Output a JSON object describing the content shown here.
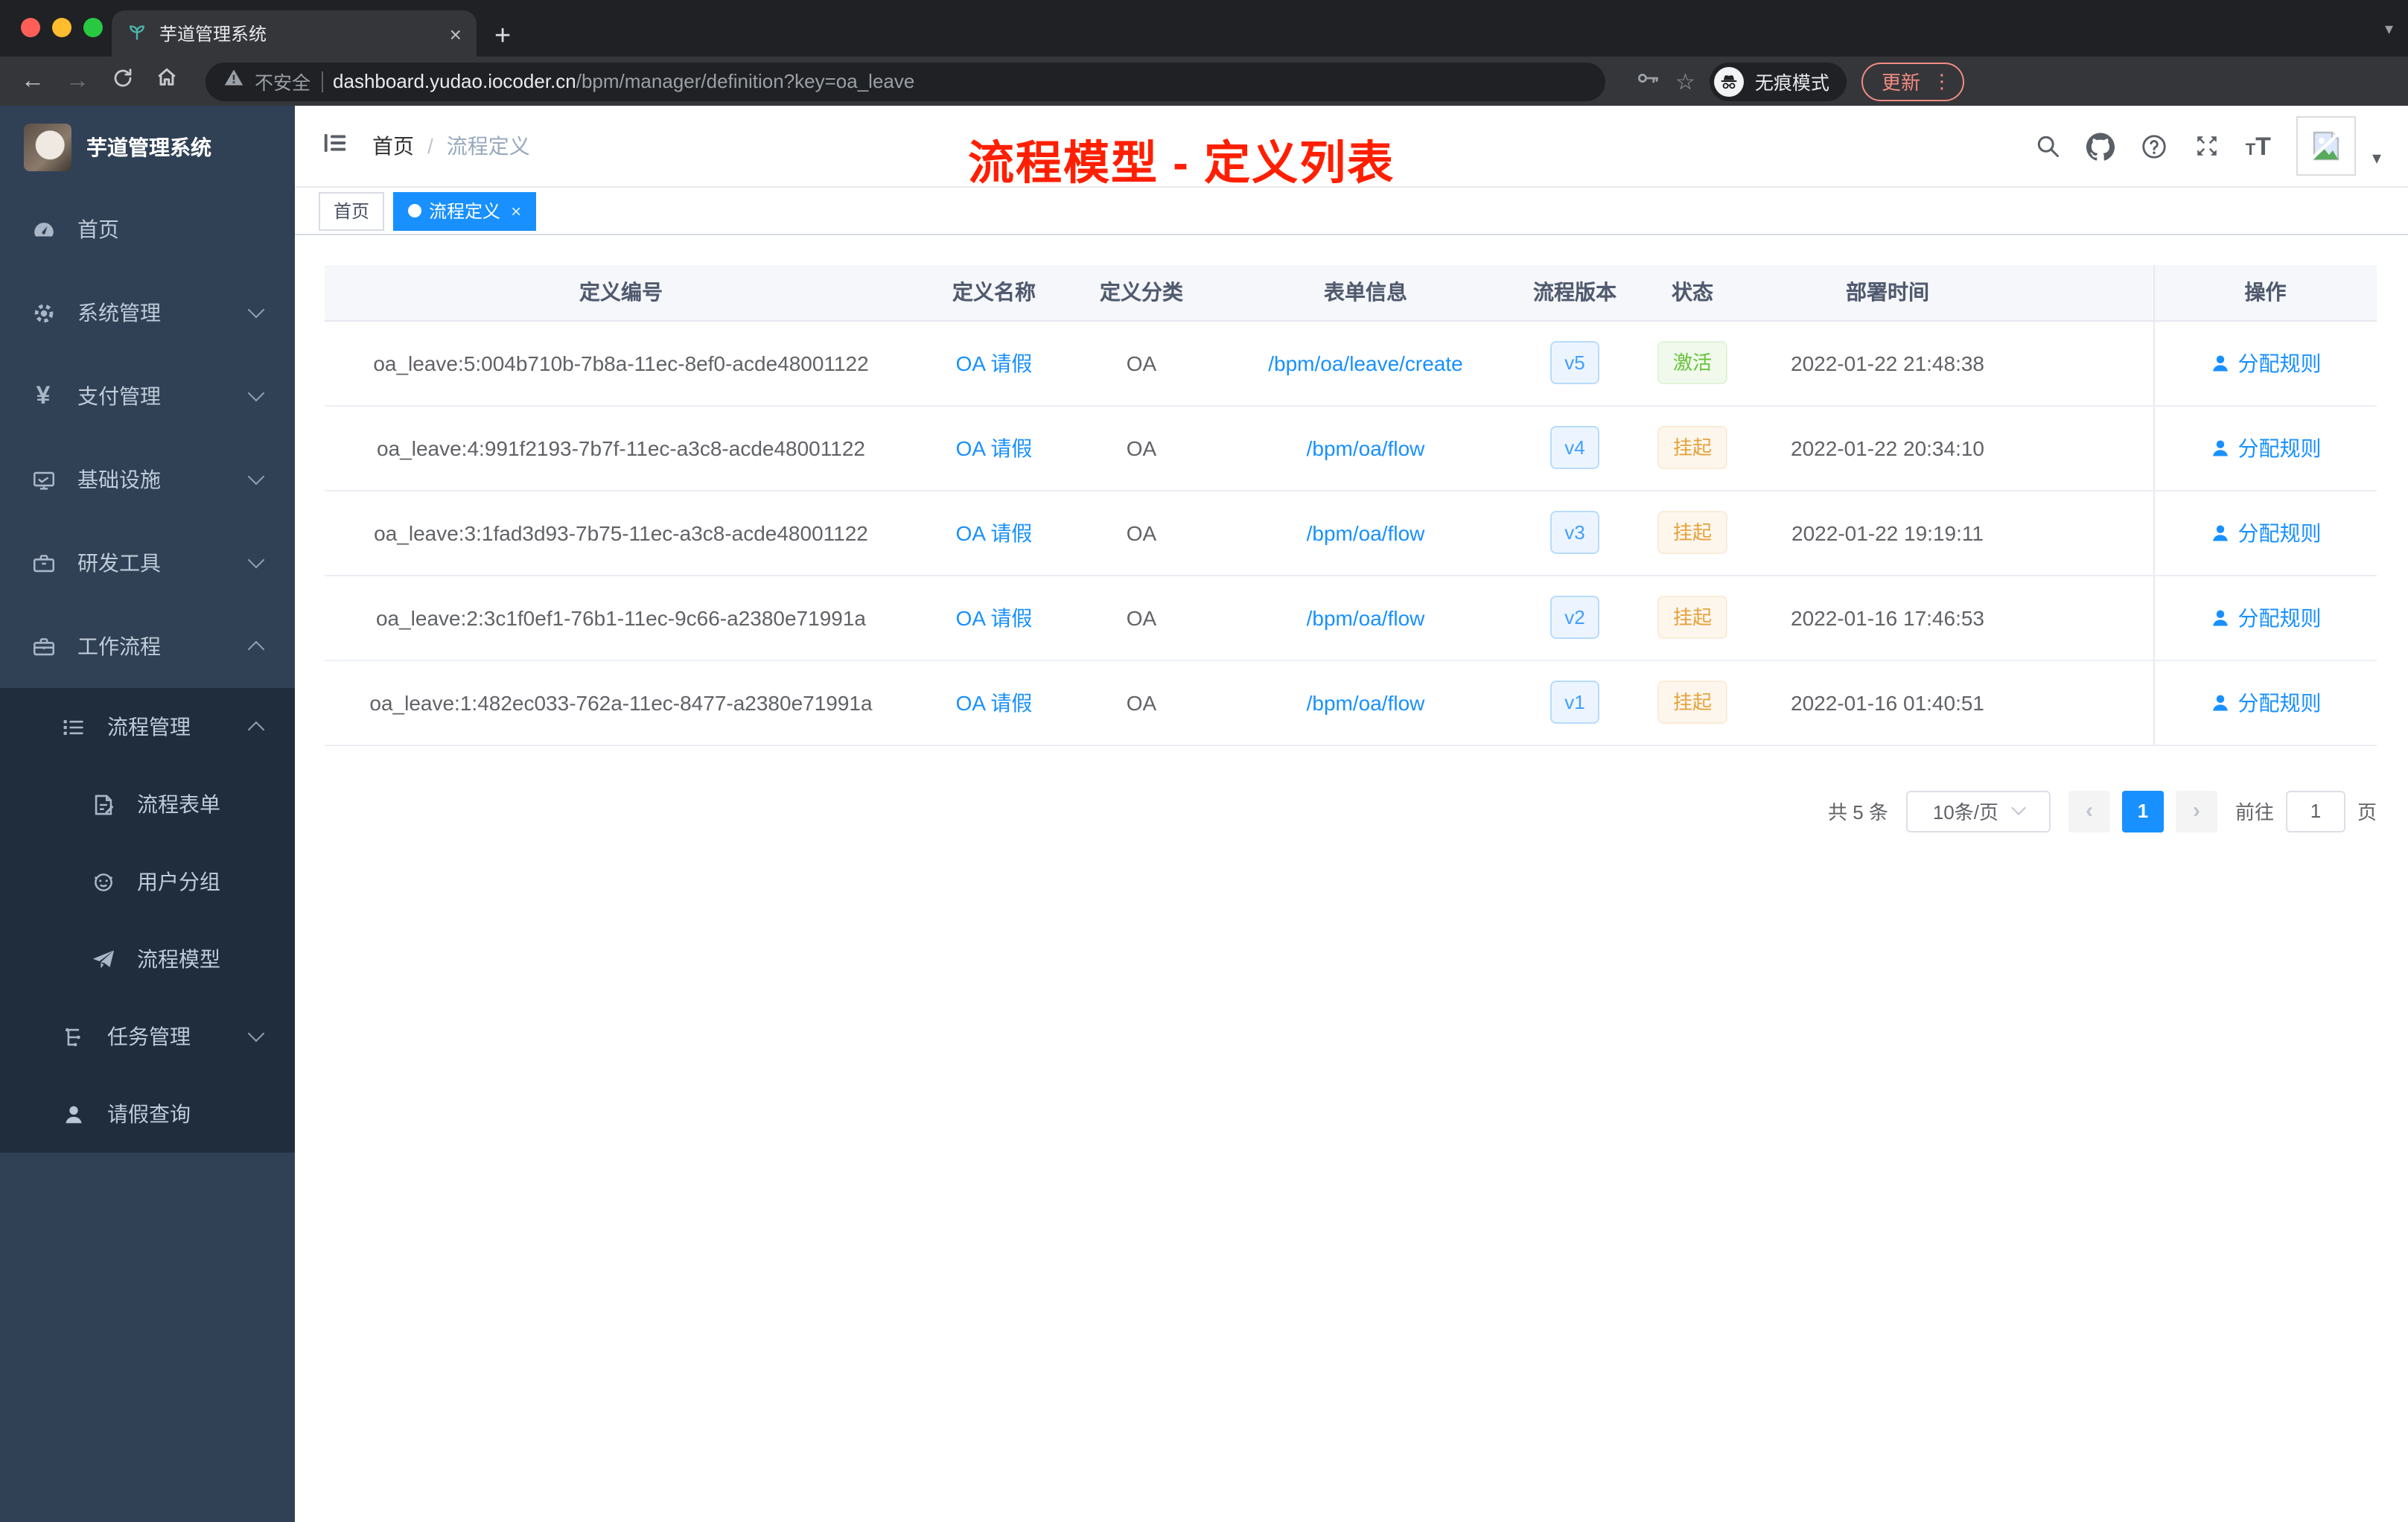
{
  "colors": {
    "accent": "#1890ff",
    "sidebar_bg": "#304156",
    "submenu_bg": "#1f2d3d",
    "success": "#67c23a",
    "warning": "#e6a23c",
    "annotation_red": "#ff1f00",
    "tag_active_bg": "#1890ff"
  },
  "browser": {
    "tab_title": "芋道管理系统",
    "new_tab": "+",
    "security_label": "不安全",
    "url_domain": "dashboard.yudao.iocoder.cn",
    "url_path": "/bpm/manager/definition?key=oa_leave",
    "incognito_label": "无痕模式",
    "update_label": "更新",
    "kebab": "⋮",
    "back": "←",
    "forward": "→",
    "star": "☆",
    "tab_caret": "▾",
    "close": "×"
  },
  "sidebar": {
    "logo_title": "芋道管理系统",
    "items": [
      {
        "label": "首页",
        "icon": "dashboard-icon"
      },
      {
        "label": "系统管理",
        "icon": "gear-icon"
      },
      {
        "label": "支付管理",
        "icon": "yen-icon"
      },
      {
        "label": "基础设施",
        "icon": "monitor-icon"
      },
      {
        "label": "研发工具",
        "icon": "toolbox-icon"
      },
      {
        "label": "工作流程",
        "icon": "briefcase-icon"
      },
      {
        "label": "流程管理",
        "icon": "list-icon"
      },
      {
        "label": "流程表单",
        "icon": "form-icon"
      },
      {
        "label": "用户分组",
        "icon": "robot-icon"
      },
      {
        "label": "流程模型",
        "icon": "paper-plane-icon"
      },
      {
        "label": "任务管理",
        "icon": "tree-icon"
      },
      {
        "label": "请假查询",
        "icon": "user-icon"
      }
    ]
  },
  "navbar": {
    "breadcrumb_home": "首页",
    "breadcrumb_sep": "/",
    "breadcrumb_current": "流程定义"
  },
  "annotation": "流程模型 - 定义列表",
  "tags": {
    "home": "首页",
    "active": "流程定义",
    "close": "×"
  },
  "table": {
    "columns": [
      "定义编号",
      "定义名称",
      "定义分类",
      "表单信息",
      "流程版本",
      "状态",
      "部署时间",
      "操作"
    ],
    "rows": [
      {
        "id": "oa_leave:5:004b710b-7b8a-11ec-8ef0-acde48001122",
        "name": "OA 请假",
        "category": "OA",
        "form": "/bpm/oa/leave/create",
        "version": "v5",
        "status": "激活",
        "status_type": "success",
        "deploy_time": "2022-01-22 21:48:38",
        "action": "分配规则"
      },
      {
        "id": "oa_leave:4:991f2193-7b7f-11ec-a3c8-acde48001122",
        "name": "OA 请假",
        "category": "OA",
        "form": "/bpm/oa/flow",
        "version": "v4",
        "status": "挂起",
        "status_type": "warning",
        "deploy_time": "2022-01-22 20:34:10",
        "action": "分配规则"
      },
      {
        "id": "oa_leave:3:1fad3d93-7b75-11ec-a3c8-acde48001122",
        "name": "OA 请假",
        "category": "OA",
        "form": "/bpm/oa/flow",
        "version": "v3",
        "status": "挂起",
        "status_type": "warning",
        "deploy_time": "2022-01-22 19:19:11",
        "action": "分配规则"
      },
      {
        "id": "oa_leave:2:3c1f0ef1-76b1-11ec-9c66-a2380e71991a",
        "name": "OA 请假",
        "category": "OA",
        "form": "/bpm/oa/flow",
        "version": "v2",
        "status": "挂起",
        "status_type": "warning",
        "deploy_time": "2022-01-16 17:46:53",
        "action": "分配规则"
      },
      {
        "id": "oa_leave:1:482ec033-762a-11ec-8477-a2380e71991a",
        "name": "OA 请假",
        "category": "OA",
        "form": "/bpm/oa/flow",
        "version": "v1",
        "status": "挂起",
        "status_type": "warning",
        "deploy_time": "2022-01-16 01:40:51",
        "action": "分配规则"
      }
    ]
  },
  "pagination": {
    "total": "共 5 条",
    "page_size": "10条/页",
    "prev": "‹",
    "current": "1",
    "next": "›",
    "goto": "前往",
    "goto_value": "1",
    "unit": "页"
  }
}
